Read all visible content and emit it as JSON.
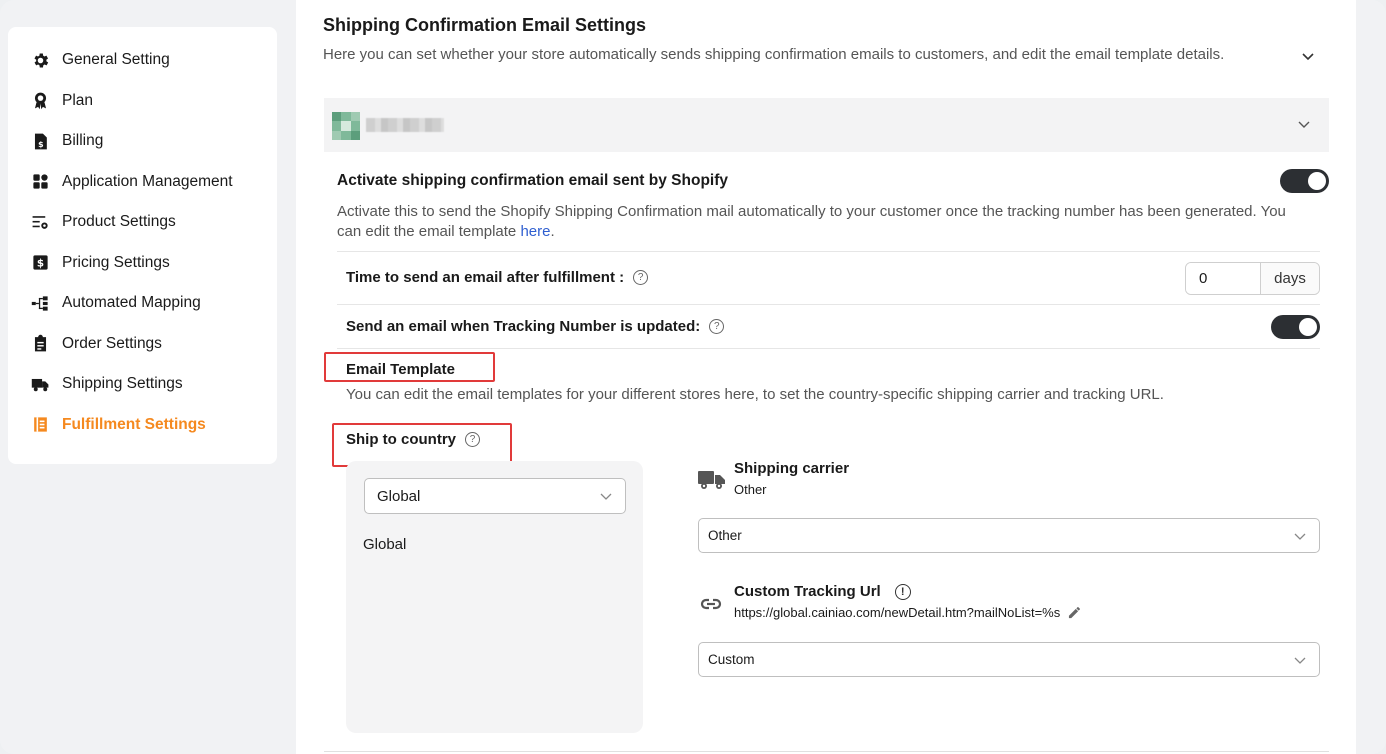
{
  "sidebar": {
    "items": [
      {
        "label": "General Setting",
        "icon": "gear-icon"
      },
      {
        "label": "Plan",
        "icon": "badge-icon"
      },
      {
        "label": "Billing",
        "icon": "invoice-icon"
      },
      {
        "label": "Application Management",
        "icon": "grid-icon"
      },
      {
        "label": "Product Settings",
        "icon": "list-settings-icon"
      },
      {
        "label": "Pricing Settings",
        "icon": "dollar-icon"
      },
      {
        "label": "Automated Mapping",
        "icon": "mapping-icon"
      },
      {
        "label": "Order Settings",
        "icon": "clipboard-icon"
      },
      {
        "label": "Shipping Settings",
        "icon": "truck-icon"
      },
      {
        "label": "Fulfillment Settings",
        "icon": "fulfillment-icon",
        "active": true
      }
    ],
    "accent_color": "#f5891f"
  },
  "main": {
    "title": "Shipping Confirmation Email Settings",
    "description": "Here you can set whether your store automatically sends shipping confirmation emails to customers, and edit the email template details.",
    "activate": {
      "title": "Activate shipping confirmation email sent by Shopify",
      "desc_prefix": "Activate this to send the Shopify Shipping Confirmation mail automatically to your customer once the tracking number has been generated. You can edit the email template ",
      "desc_link": "here",
      "desc_suffix": ".",
      "enabled": true
    },
    "time_to_send": {
      "label": "Time to send an email after fulfillment :",
      "value": "0",
      "unit": "days"
    },
    "tracking_update": {
      "label": "Send an email when Tracking Number is updated:",
      "enabled": true
    },
    "email_template": {
      "title": "Email Template",
      "description": "You can edit the email templates for your different stores here, to set the country-specific shipping carrier and tracking URL."
    },
    "ship_to_country": {
      "title": "Ship to country",
      "selected": "Global",
      "list": [
        "Global"
      ]
    },
    "shipping_carrier": {
      "title": "Shipping carrier",
      "current": "Other",
      "selected": "Other"
    },
    "custom_tracking": {
      "title": "Custom Tracking Url",
      "url": "https://global.cainiao.com/newDetail.htm?mailNoList=%s",
      "selected": "Custom"
    },
    "help_glyph": "?",
    "info_glyph": "!"
  }
}
